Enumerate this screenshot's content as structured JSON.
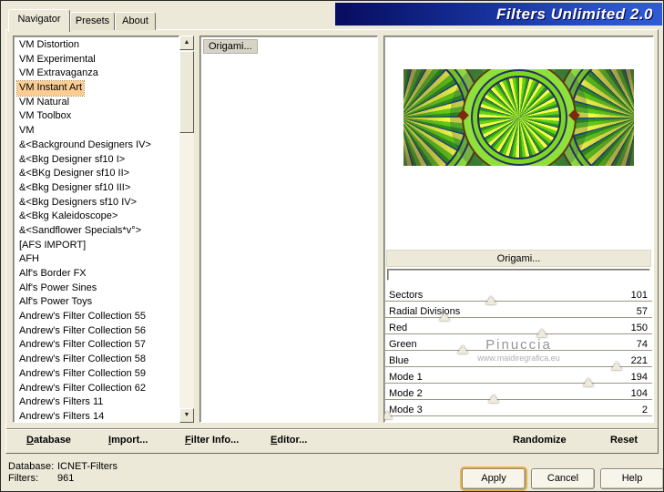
{
  "window": {
    "title": "Filters Unlimited 2.0"
  },
  "tabs": [
    {
      "label": "Navigator",
      "active": true
    },
    {
      "label": "Presets",
      "active": false
    },
    {
      "label": "About",
      "active": false
    }
  ],
  "icons": {
    "scroll_up": "▲",
    "scroll_down": "▼"
  },
  "navigator": {
    "items": [
      "VM Distortion",
      "VM Experimental",
      "VM Extravaganza",
      "VM Instant Art",
      "VM Natural",
      "VM Toolbox",
      "VM",
      "&<Background Designers IV>",
      "&<Bkg Designer sf10 I>",
      "&<BKg Designer sf10 II>",
      "&<Bkg Designer sf10 III>",
      "&<Bkg Designers sf10 IV>",
      "&<Bkg Kaleidoscope>",
      "&<Sandflower Specials*v°>",
      "[AFS IMPORT]",
      "AFH",
      "Alf's Border FX",
      "Alf's Power Sines",
      "Alf's Power Toys",
      "Andrew's Filter Collection 55",
      "Andrew's Filter Collection 56",
      "Andrew's Filter Collection 57",
      "Andrew's Filter Collection 58",
      "Andrew's Filter Collection 59",
      "Andrew's Filter Collection 62",
      "Andrew's Filters 11",
      "Andrew's Filters 14"
    ],
    "selected": "VM Instant Art"
  },
  "filters": {
    "items": [
      "Origami..."
    ],
    "selected": "Origami..."
  },
  "preview": {
    "label": "Origami..."
  },
  "params": [
    {
      "label": "Sectors",
      "value": 101
    },
    {
      "label": "Radial Divisions",
      "value": 57
    },
    {
      "label": "Red",
      "value": 150
    },
    {
      "label": "Green",
      "value": 74
    },
    {
      "label": "Blue",
      "value": 221
    },
    {
      "label": "Mode 1",
      "value": 194
    },
    {
      "label": "Mode 2",
      "value": 104
    },
    {
      "label": "Mode 3",
      "value": 2
    }
  ],
  "watermark": {
    "name": "Pinuccia",
    "site": "www.maidiregrafica.eu"
  },
  "menu": {
    "database": "Database",
    "import": "Import...",
    "filter_info": "Filter Info...",
    "editor": "Editor...",
    "randomize": "Randomize",
    "reset": "Reset"
  },
  "status": {
    "database_label": "Database:",
    "database_value": "ICNET-Filters",
    "filters_label": "Filters:",
    "filters_value": "961"
  },
  "action_buttons": {
    "apply": "Apply",
    "cancel": "Cancel",
    "help": "Help"
  },
  "colors": {
    "window_bg": "#ECE9D8",
    "banner_start": "#070C5E",
    "banner_end": "#2E5AD4",
    "selection_highlight": "#FBCD92",
    "apply_focus_ring": "#EBB24C"
  }
}
